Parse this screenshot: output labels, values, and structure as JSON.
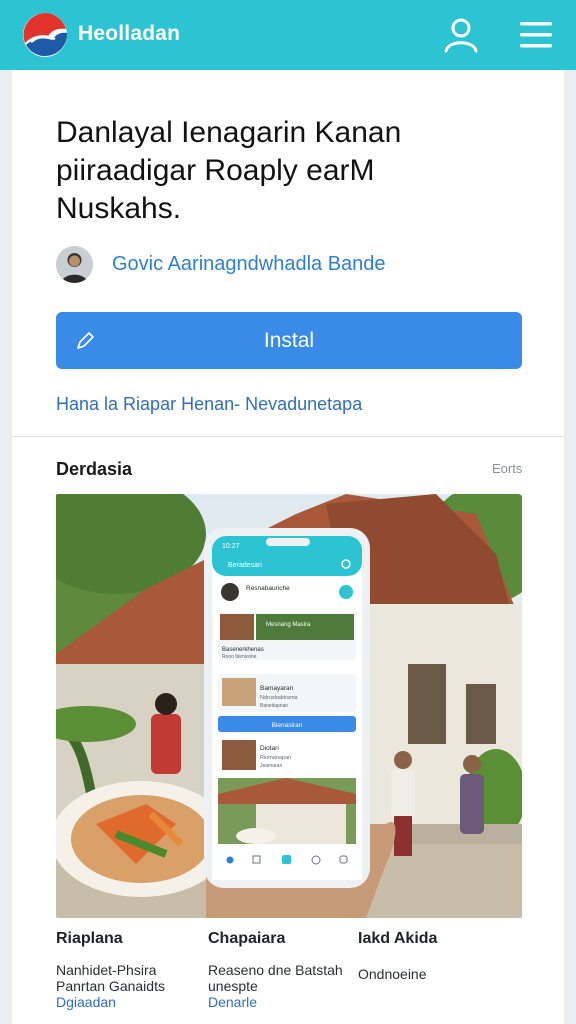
{
  "header": {
    "brand": "Heolladan",
    "colors": {
      "bar": "#2cc3d2",
      "logo_red": "#e0342c",
      "logo_blue": "#1f5aa6"
    },
    "icons": {
      "logo": "bird-logo-icon",
      "user": "user-icon",
      "menu": "hamburger-menu-icon"
    }
  },
  "app": {
    "title": "Danlayal Ienagarin Kanan piiraadigar Roaply earM Nuskahs.",
    "developer": "Govic Aarinagndwhadla Bande",
    "install_label": "Instal",
    "install_icon": "pencil-icon",
    "developer_link": "Hana la Riapar Henan- Nevadunetapa",
    "accent": "#3a8ae8"
  },
  "screenshots": {
    "section_title": "Derdasia",
    "more_link": "Eorts",
    "phone": {
      "status_time": "10:27",
      "app_header": "Beradesari",
      "profile_text": "Resnabauriche",
      "cards": [
        {
          "title": "Mesnang Masira",
          "subtitle": "Basenerkhenas",
          "meta": "Rooo blenssine"
        },
        {
          "title": "Bamayaran",
          "subtitle": "Ndrusbaktrama",
          "meta": "Baneitapnan"
        }
      ],
      "button_label": "Bienasiran",
      "item": {
        "title": "Diotari",
        "subtitle": "Riomanapan",
        "meta": "Jeamaran"
      },
      "nav_icons": [
        "home-icon",
        "chat-icon",
        "grid-icon",
        "bell-icon",
        "profile-icon"
      ]
    }
  },
  "info": [
    {
      "heading": "Riaplana",
      "lines": [
        "Nanhidet-Phsira",
        "Panrtan Ganaidts"
      ],
      "link": "Dgiaadan"
    },
    {
      "heading": "Chapaiara",
      "lines": [
        "Reaseno dne Batstah",
        "unespte"
      ],
      "link": "Denarle"
    },
    {
      "heading": "Iakd Akida",
      "lines": [
        "Ondnoeine"
      ],
      "link": ""
    }
  ]
}
